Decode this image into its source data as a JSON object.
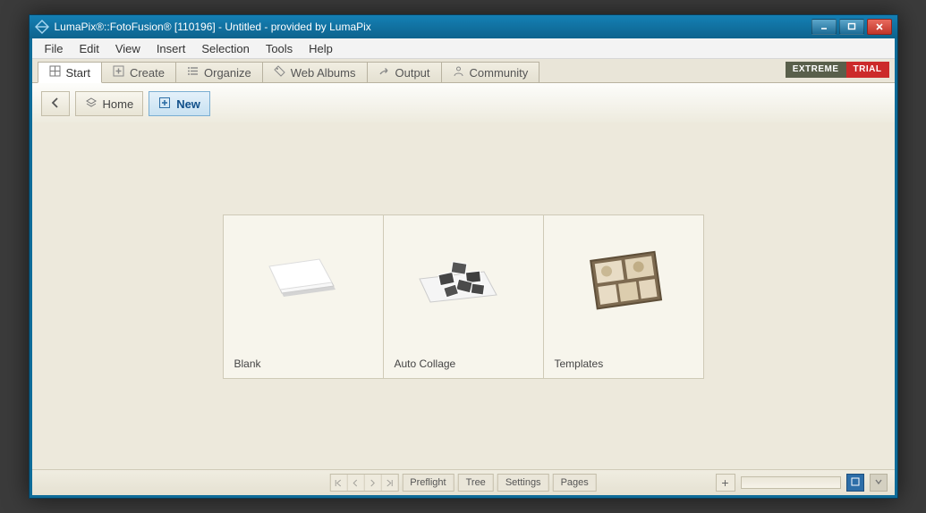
{
  "titlebar": {
    "text": "LumaPix®::FotoFusion® [110196] - Untitled - provided by LumaPix"
  },
  "menu": [
    "File",
    "Edit",
    "View",
    "Insert",
    "Selection",
    "Tools",
    "Help"
  ],
  "tabs": [
    {
      "label": "Start",
      "icon": "grid"
    },
    {
      "label": "Create",
      "icon": "plus-box"
    },
    {
      "label": "Organize",
      "icon": "list"
    },
    {
      "label": "Web Albums",
      "icon": "tag"
    },
    {
      "label": "Output",
      "icon": "arrow-out"
    },
    {
      "label": "Community",
      "icon": "people"
    }
  ],
  "badges": {
    "extreme": "EXTREME",
    "trial": "TRIAL"
  },
  "subtoolbar": {
    "home_label": "Home",
    "new_label": "New"
  },
  "cards": [
    {
      "caption": "Blank"
    },
    {
      "caption": "Auto Collage"
    },
    {
      "caption": "Templates"
    }
  ],
  "statusbar": {
    "preflight": "Preflight",
    "tree": "Tree",
    "settings": "Settings",
    "pages": "Pages"
  }
}
